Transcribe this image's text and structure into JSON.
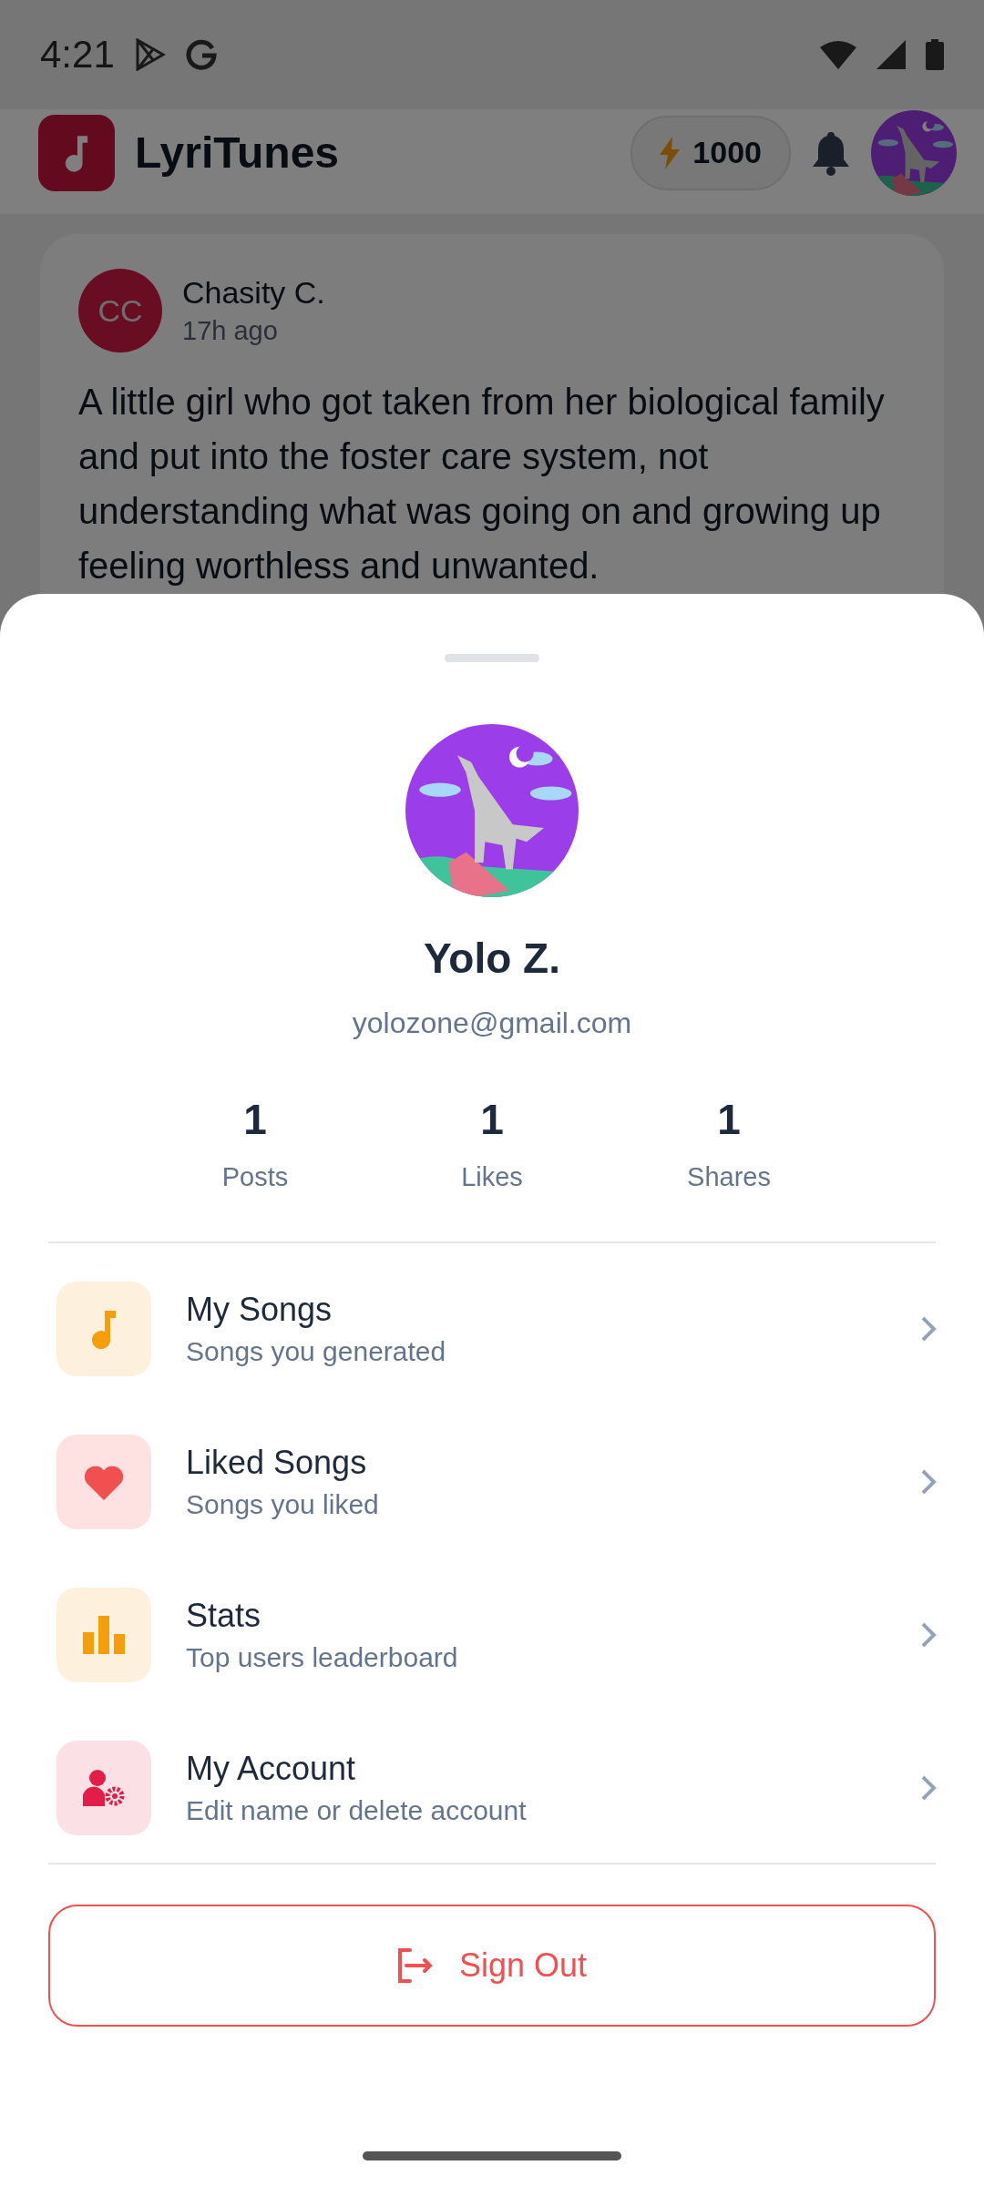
{
  "status_bar": {
    "time": "4:21"
  },
  "header": {
    "app_name": "LyriTunes",
    "credits": "1000"
  },
  "post": {
    "initials": "CC",
    "author": "Chasity C.",
    "time": "17h ago",
    "text": "A little girl who got taken from her biological family and put into the foster care system, not understanding what was going on and growing up feeling worthless and unwanted."
  },
  "profile": {
    "name": "Yolo Z.",
    "email": "yolozone@gmail.com",
    "stats": [
      {
        "value": "1",
        "label": "Posts"
      },
      {
        "value": "1",
        "label": "Likes"
      },
      {
        "value": "1",
        "label": "Shares"
      }
    ],
    "menu": [
      {
        "kind": "songs",
        "title": "My Songs",
        "subtitle": "Songs you generated"
      },
      {
        "kind": "liked",
        "title": "Liked Songs",
        "subtitle": "Songs you liked"
      },
      {
        "kind": "stats",
        "title": "Stats",
        "subtitle": "Top users leaderboard"
      },
      {
        "kind": "account",
        "title": "My Account",
        "subtitle": "Edit name or delete account"
      }
    ],
    "sign_out": "Sign Out"
  }
}
